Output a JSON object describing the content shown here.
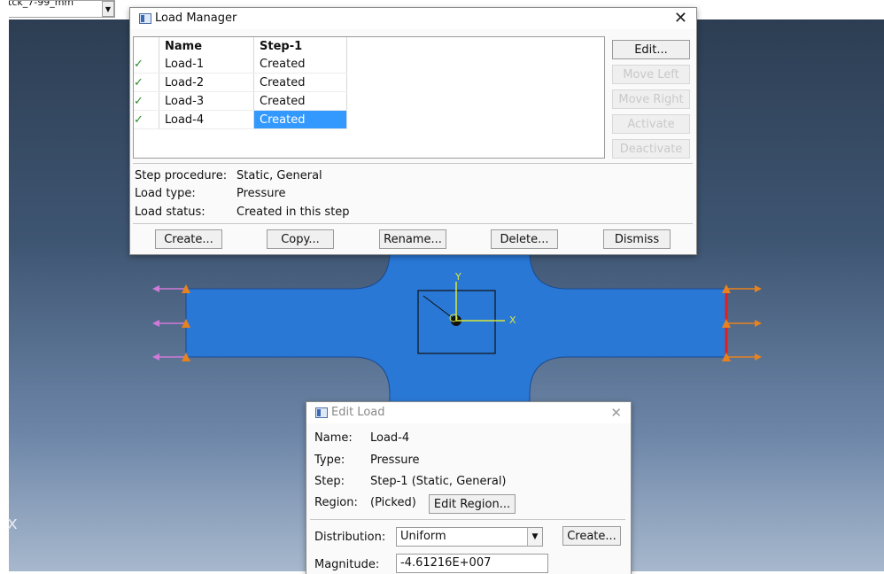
{
  "topbar": {
    "part_combo_text": "tck_7-99_mm",
    "combo_arrow": "chevron-down-icon"
  },
  "viewport": {
    "edge_glyph": "x"
  },
  "triad": {
    "y_label": "Y",
    "x_label": "X"
  },
  "load_manager": {
    "title": "Load Manager",
    "close_glyph": "✕",
    "columns": [
      "Name",
      "Step-1"
    ],
    "rows": [
      {
        "check": "✓",
        "name": "Load-1",
        "state": "Created"
      },
      {
        "check": "✓",
        "name": "Load-2",
        "state": "Created"
      },
      {
        "check": "✓",
        "name": "Load-3",
        "state": "Created"
      },
      {
        "check": "✓",
        "name": "Load-4",
        "state": "Created"
      }
    ],
    "side_buttons": [
      "Edit...",
      "Move Left",
      "Move Right",
      "Activate",
      "Deactivate"
    ],
    "step_procedure_label": "Step procedure:",
    "step_procedure_value": "Static, General",
    "load_type_label": "Load type:",
    "load_type_value": "Pressure",
    "load_status_label": "Load status:",
    "load_status_value": "Created in this step",
    "bottom_buttons": [
      "Create...",
      "Copy...",
      "Rename...",
      "Delete...",
      "Dismiss"
    ]
  },
  "edit_load": {
    "title": "Edit Load",
    "close_glyph": "✕",
    "name_label": "Name:",
    "name_value": "Load-4",
    "type_label": "Type:",
    "type_value": "Pressure",
    "step_label": "Step:",
    "step_value": "Step-1 (Static, General)",
    "region_label": "Region:",
    "region_value": "(Picked)",
    "edit_region_button": "Edit Region...",
    "distribution_label": "Distribution:",
    "distribution_value": "Uniform",
    "distribution_create_button": "Create...",
    "magnitude_label": "Magnitude:",
    "magnitude_value": "-4.61216E+007"
  },
  "colors": {
    "part_fill": "#2a78d6",
    "left_arrow": "#d07ad8",
    "right_arrow": "#e8821e",
    "edge_highlight": "#e02020",
    "triad_axis": "#d8e83a",
    "selection": "#3399ff",
    "check": "#2a8a2a"
  }
}
